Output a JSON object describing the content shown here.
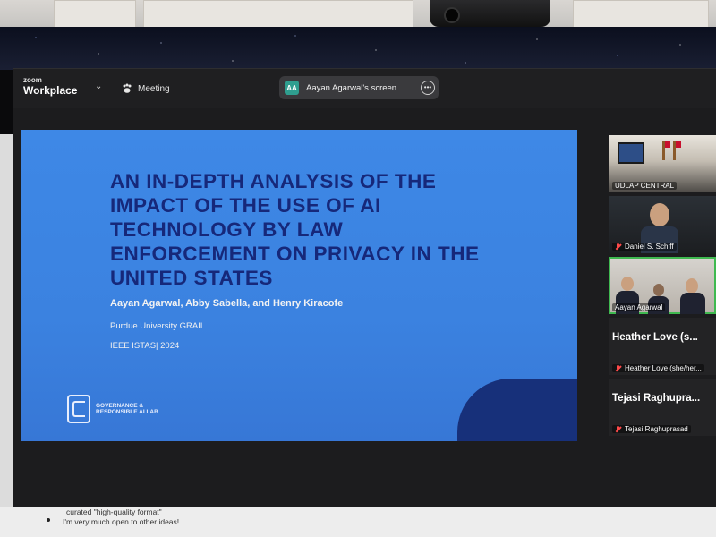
{
  "zoom": {
    "brand_small": "zoom",
    "brand_big": "Workplace",
    "meeting_label": "Meeting",
    "share_avatar": "AA",
    "share_label": "Aayan Agarwal's screen",
    "more_glyph": "•••"
  },
  "slide": {
    "title": "AN IN-DEPTH ANALYSIS OF THE IMPACT OF THE USE OF AI TECHNOLOGY BY LAW ENFORCEMENT ON PRIVACY IN THE UNITED STATES",
    "authors": "Aayan Agarwal, Abby Sabella, and Henry Kiracofe",
    "affiliation": "Purdue University GRAIL",
    "venue": "IEEE ISTAS| 2024",
    "logo_text": "GOVERNANCE & RESPONSIBLE AI LAB",
    "colors": {
      "background": "#3b82e0",
      "title": "#16287a",
      "accent_shape": "#17307a"
    }
  },
  "participants": [
    {
      "name": "UDLAP CENTRAL",
      "muted": false,
      "video": true
    },
    {
      "name": "Daniel S. Schiff",
      "muted": true,
      "video": true
    },
    {
      "name": "Aayan Agarwal",
      "muted": false,
      "video": true,
      "active_speaker": true
    },
    {
      "name": "Heather Love (she/her...",
      "display": "Heather Love  (s...",
      "muted": true,
      "video": false
    },
    {
      "name": "Tejasi Raghuprasad",
      "display": "Tejasi  Raghupra...",
      "muted": true,
      "video": false
    }
  ],
  "document_below": {
    "line1": "curated \"high-quality format\"",
    "line2": "I'm very much open to other ideas!"
  }
}
